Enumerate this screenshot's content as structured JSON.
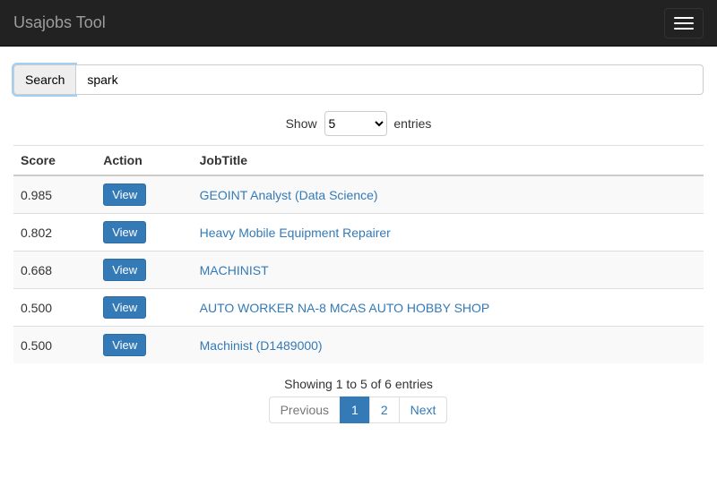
{
  "navbar": {
    "brand": "Usajobs Tool"
  },
  "search": {
    "button_label": "Search",
    "value": "spark"
  },
  "length_control": {
    "prefix": "Show",
    "selected": "5",
    "suffix": "entries"
  },
  "table": {
    "headers": {
      "score": "Score",
      "action": "Action",
      "jobtitle": "JobTitle"
    },
    "view_label": "View",
    "rows": [
      {
        "score": "0.985",
        "title": "GEOINT Analyst (Data Science)"
      },
      {
        "score": "0.802",
        "title": "Heavy Mobile Equipment Repairer"
      },
      {
        "score": "0.668",
        "title": "MACHINIST"
      },
      {
        "score": "0.500",
        "title": "AUTO WORKER NA-8 MCAS AUTO HOBBY SHOP"
      },
      {
        "score": "0.500",
        "title": "Machinist (D1489000)"
      }
    ]
  },
  "info": "Showing 1 to 5 of 6 entries",
  "pagination": {
    "previous": "Previous",
    "pages": [
      "1",
      "2"
    ],
    "active_index": 0,
    "next": "Next"
  }
}
